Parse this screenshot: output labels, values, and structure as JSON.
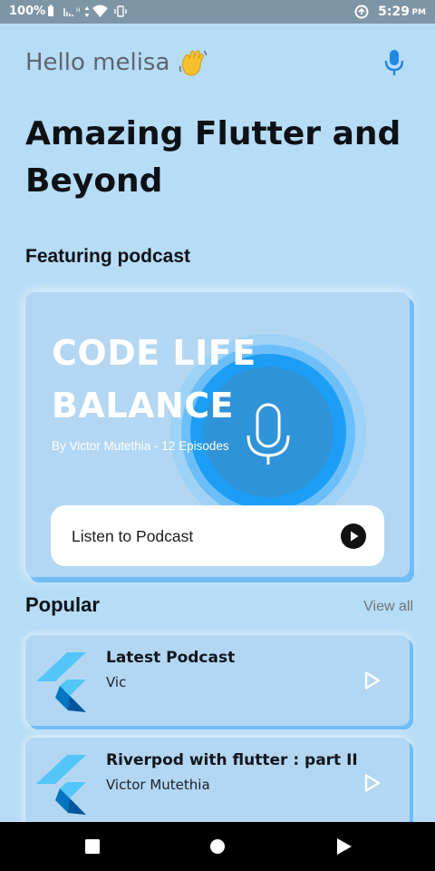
{
  "status_bar": {
    "battery": "100%",
    "time": "5:29",
    "ampm": "PM"
  },
  "header": {
    "greeting": "Hello melisa",
    "greeting_icon": "waving-hand-icon",
    "action_icon": "microphone-icon"
  },
  "page": {
    "title": "Amazing Flutter and Beyond"
  },
  "featured": {
    "section_title": "Featuring podcast",
    "podcast_title": "CODE LIFE BALANCE",
    "subtitle": "By Victor Mutethia - 12 Episodes",
    "button_label": "Listen to Podcast",
    "button_icon": "play-circle-icon",
    "art_icon": "microphone-icon"
  },
  "popular": {
    "section_title": "Popular",
    "view_all": "View all",
    "items": [
      {
        "title": "Latest Podcast",
        "author": "Vic",
        "logo": "flutter-logo-icon",
        "action_icon": "play-icon"
      },
      {
        "title": "Riverpod with flutter : part II",
        "author": "Victor Mutethia",
        "logo": "flutter-logo-icon",
        "action_icon": "play-icon"
      }
    ]
  },
  "navigation": {
    "buttons": [
      "recents-icon",
      "home-icon",
      "back-icon"
    ]
  },
  "colors": {
    "background": "#b7dcf6",
    "card_shadow": "#70bdf7",
    "accent_blue": "#1e88e5",
    "glow_blue": "#1e9cf0",
    "status_bar": "#7e95a6",
    "text_dark": "#0d1116"
  }
}
